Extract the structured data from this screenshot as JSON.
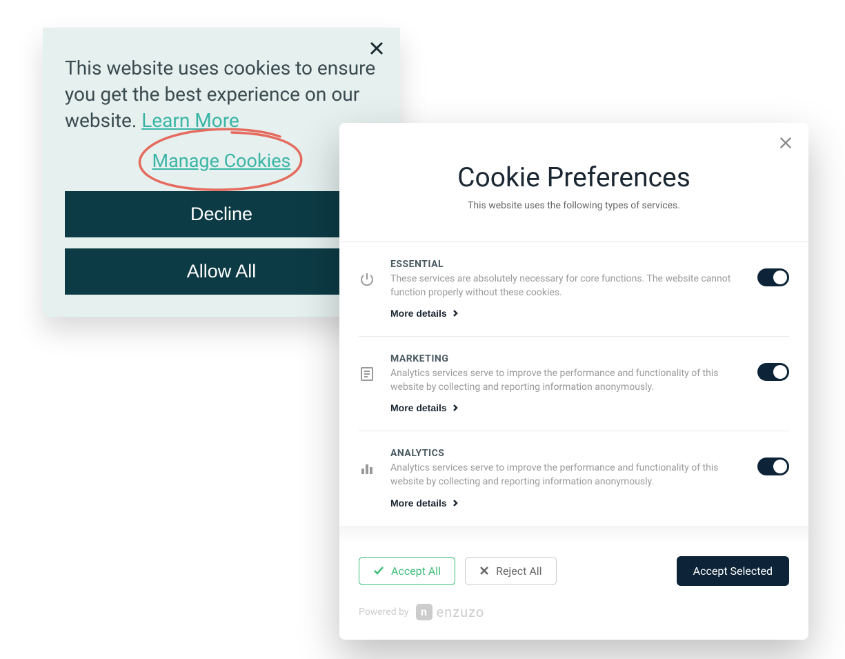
{
  "banner": {
    "message_part1": "This website uses cookies to ensure you get the best experience on our website. ",
    "learn_more": "Learn More",
    "manage": "Manage Cookies",
    "decline": "Decline",
    "allow": "Allow All"
  },
  "modal": {
    "title": "Cookie Preferences",
    "subtitle": "This website uses the following types of services.",
    "categories": [
      {
        "title": "ESSENTIAL",
        "description": "These services are absolutely necessary for core functions. The website cannot function properly without these cookies.",
        "more": "More details",
        "enabled": true
      },
      {
        "title": "MARKETING",
        "description": "Analytics services serve to improve the performance and functionality of this website by collecting and reporting information anonymously.",
        "more": "More details",
        "enabled": true
      },
      {
        "title": "ANALYTICS",
        "description": "Analytics services serve to improve the performance and functionality of this website by collecting and reporting information anonymously.",
        "more": "More details",
        "enabled": true
      }
    ],
    "accept_all": "Accept All",
    "reject_all": "Reject All",
    "accept_selected": "Accept Selected",
    "powered_by": "Powered by",
    "brand": "enzuzo"
  }
}
